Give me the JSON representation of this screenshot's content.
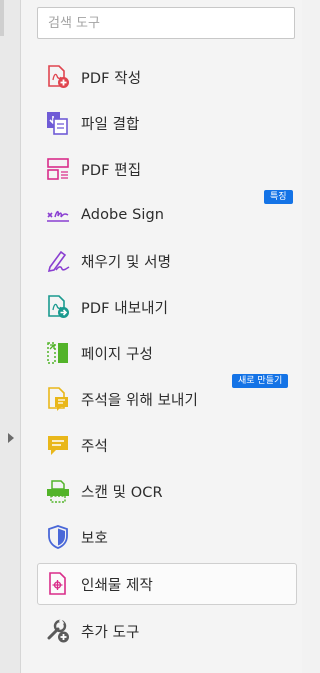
{
  "search": {
    "placeholder": "검색 도구"
  },
  "tools": [
    {
      "label": "PDF 작성",
      "icon": "create-pdf-icon"
    },
    {
      "label": "파일 결합",
      "icon": "combine-files-icon"
    },
    {
      "label": "PDF 편집",
      "icon": "edit-pdf-icon"
    },
    {
      "label": "Adobe Sign",
      "icon": "adobe-sign-icon",
      "badge": "특징"
    },
    {
      "label": "채우기 및 서명",
      "icon": "fill-sign-icon"
    },
    {
      "label": "PDF 내보내기",
      "icon": "export-pdf-icon"
    },
    {
      "label": "페이지 구성",
      "icon": "organize-pages-icon"
    },
    {
      "label": "주석을 위해 보내기",
      "icon": "send-for-comments-icon",
      "badge": "새로 만들기"
    },
    {
      "label": "주석",
      "icon": "comment-icon"
    },
    {
      "label": "스캔 및 OCR",
      "icon": "scan-ocr-icon"
    },
    {
      "label": "보호",
      "icon": "protect-shield-icon"
    },
    {
      "label": "인쇄물 제작",
      "icon": "print-production-icon",
      "selected": true
    },
    {
      "label": "추가 도구",
      "icon": "add-tools-icon"
    }
  ],
  "colors": {
    "red": "#e0454f",
    "purple": "#9b3fd1",
    "pink": "#d92d8a",
    "teal": "#1a9a8f",
    "green": "#52b329",
    "yellow": "#e9b71a",
    "blue": "#4a68d8",
    "badge_blue": "#1473e6"
  }
}
